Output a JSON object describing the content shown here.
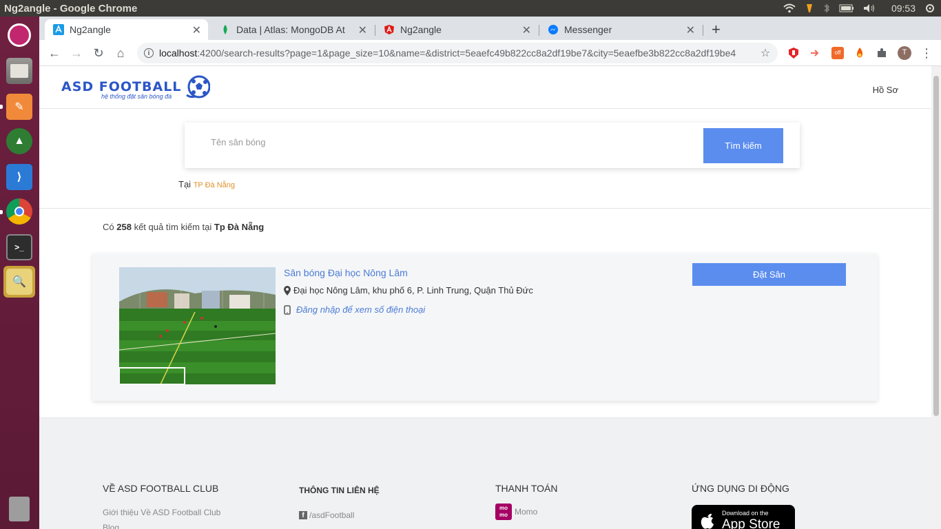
{
  "os": {
    "window_title": "Ng2angle - Google Chrome",
    "clock": "09:53"
  },
  "launcher": {
    "apps": [
      "ubuntu-dash-icon",
      "files-icon",
      "editor-icon",
      "robo3t-icon",
      "vscode-icon",
      "chrome-icon",
      "terminal-icon",
      "image-viewer-icon"
    ],
    "trash": "trash-icon"
  },
  "browser": {
    "tabs": [
      {
        "label": "Ng2angle",
        "favicon": "angular-blue-icon"
      },
      {
        "label": "Data | Atlas: MongoDB At",
        "favicon": "mongodb-leaf-icon"
      },
      {
        "label": "Ng2angle",
        "favicon": "angular-red-icon"
      },
      {
        "label": "Messenger",
        "favicon": "messenger-icon"
      }
    ],
    "url_host": "localhost",
    "url_rest": ":4200/search-results?page=1&page_size=10&name=&district=5eaefc49b822cc8a2df19be7&city=5eaefbe3b822cc8a2df19be4",
    "profile_initial": "T"
  },
  "site": {
    "logo_text": "ASD FOOTBALL",
    "logo_tagline": "hệ thống đặt sân bóng đá",
    "profile_link": "Hồ Sơ",
    "search": {
      "placeholder": "Tên sân bóng",
      "button": "Tìm kiếm"
    },
    "location_prefix": "Tại",
    "location_city": "TP Đà Nẵng",
    "summary": {
      "prefix": "Có",
      "count": "258",
      "middle": "kết quả tìm kiếm tại",
      "city": "Tp Đà Nẵng"
    },
    "results": [
      {
        "name": "Sân bóng Đại học Nông Lâm",
        "address": "Đại học Nông Lâm, khu phố 6, P. Linh Trung, Quận Thủ Đức",
        "phone_note": "Đăng nhập để xem số điện thoại",
        "book_button": "Đặt Sân"
      }
    ],
    "footer": {
      "about_heading": "VỀ ASD FOOTBALL CLUB",
      "about_link": "Giới thiệu Về ASD Football Club",
      "about_link2": "Blog",
      "contact_heading": "THÔNG TIN LIÊN HỆ",
      "contact_facebook": "/asdFootball",
      "payment_heading": "THANH TOÁN",
      "payment_momo": "Momo",
      "app_heading": "ỨNG DỤNG DI ĐỘNG",
      "appstore_small": "Download on the",
      "appstore_big": "App Store"
    }
  }
}
